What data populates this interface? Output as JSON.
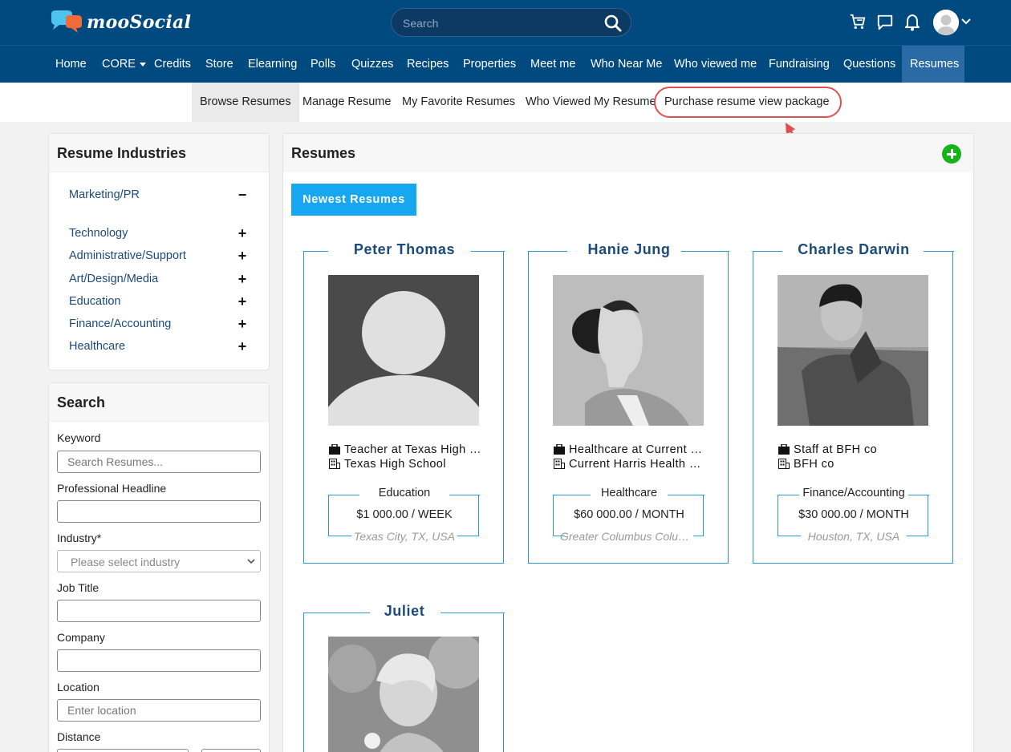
{
  "brand": {
    "name": "mooSocial"
  },
  "header": {
    "search_placeholder": "Search",
    "icons": [
      "cart-icon",
      "chat-icon",
      "bell-icon",
      "user-avatar"
    ]
  },
  "nav": {
    "items": [
      {
        "label": "Home"
      },
      {
        "label": "CORE"
      },
      {
        "label": "Credits"
      },
      {
        "label": "Store"
      },
      {
        "label": "Elearning"
      },
      {
        "label": "Polls"
      },
      {
        "label": "Quizzes"
      },
      {
        "label": "Recipes"
      },
      {
        "label": "Properties"
      },
      {
        "label": "Meet me"
      },
      {
        "label": "Who Near Me"
      },
      {
        "label": "Who viewed me"
      },
      {
        "label": "Fundraising"
      },
      {
        "label": "Questions"
      },
      {
        "label": "Resumes"
      }
    ],
    "active": "Resumes"
  },
  "subnav": {
    "items": [
      {
        "label": "Browse Resumes"
      },
      {
        "label": "Manage Resume"
      },
      {
        "label": "My Favorite Resumes"
      },
      {
        "label": "Who Viewed My Resume"
      },
      {
        "label": "Purchase resume view package"
      }
    ],
    "active": "Browse Resumes",
    "highlighted": "Purchase resume view package"
  },
  "industries": {
    "title": "Resume Industries",
    "items": [
      {
        "label": "Marketing/PR",
        "sign": "−"
      },
      {
        "label": "Technology",
        "sign": "+"
      },
      {
        "label": "Administrative/Support",
        "sign": "+"
      },
      {
        "label": "Art/Design/Media",
        "sign": "+"
      },
      {
        "label": "Education",
        "sign": "+"
      },
      {
        "label": "Finance/Accounting",
        "sign": "+"
      },
      {
        "label": "Healthcare",
        "sign": "+"
      }
    ]
  },
  "search": {
    "title": "Search",
    "keyword_label": "Keyword",
    "keyword_placeholder": "Search Resumes...",
    "headline_label": "Professional Headline",
    "industry_label": "Industry*",
    "industry_placeholder": "Please select industry",
    "jobtitle_label": "Job Title",
    "company_label": "Company",
    "location_label": "Location",
    "location_placeholder": "Enter location",
    "distance_label": "Distance"
  },
  "main": {
    "title": "Resumes",
    "tab": "Newest Resumes",
    "accent": "#17a6f0",
    "add_color": "#17b31a"
  },
  "resumes": [
    {
      "name": "Peter Thomas",
      "job": "Teacher at Texas High School",
      "company": "Texas High School",
      "industry": "Education",
      "salary": "$1 000.00 / WEEK",
      "location": "Texas City, TX, USA"
    },
    {
      "name": "Hanie Jung",
      "job": "Healthcare at Current Harris Health",
      "company": "Current Harris Health System",
      "industry": "Healthcare",
      "salary": "$60 000.00 / MONTH",
      "location": "Greater Columbus Columbus"
    },
    {
      "name": "Charles Darwin",
      "job": "Staff at BFH co",
      "company": "BFH co",
      "industry": "Finance/Accounting",
      "salary": "$30 000.00 / MONTH",
      "location": "Houston, TX, USA"
    },
    {
      "name": "Juliet"
    }
  ]
}
